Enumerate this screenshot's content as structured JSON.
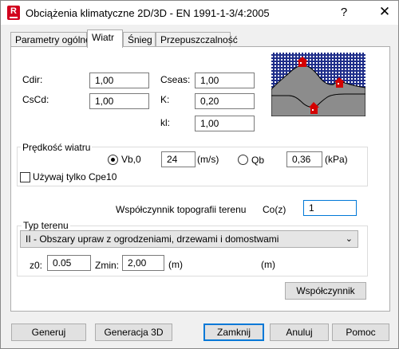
{
  "window": {
    "title": "Obciążenia klimatyczne 2D/3D - EN 1991-1-3/4:2005",
    "help_label": "?",
    "close_label": "✕",
    "app_icon_letter": "R"
  },
  "tabs": [
    {
      "label": "Parametry ogólne",
      "active": false
    },
    {
      "label": "Wiatr",
      "active": true
    },
    {
      "label": "Śnieg",
      "active": false
    },
    {
      "label": "Przepuszczalność",
      "active": false
    }
  ],
  "params": {
    "cdir_label": "Cdir:",
    "cdir_value": "1,00",
    "cscd_label": "CsCd:",
    "cscd_value": "1,00",
    "cseas_label": "Cseas:",
    "cseas_value": "1,00",
    "k_label": "K:",
    "k_value": "0,20",
    "kl_label": "kl:",
    "kl_value": "1,00"
  },
  "wind_speed": {
    "group_title": "Prędkość wiatru",
    "vb_label": "Vb,0",
    "vb_value": "24",
    "vb_unit": "(m/s)",
    "qb_label": "Qb",
    "qb_value": "0,36",
    "qb_unit": "(kPa)",
    "selected": "vb",
    "cpe10_label": "Używaj tylko Cpe10",
    "cpe10_checked": false
  },
  "topography": {
    "label": "Współczynnik topografii terenu",
    "coz_label": "Co(z)",
    "coz_value": "1"
  },
  "terrain": {
    "group_title": "Typ terenu",
    "selected_option": "II - Obszary upraw z ogrodzeniami, drzewami i domostwami",
    "z0_label": "z0:",
    "z0_value": "0.05",
    "zmin_label": "Zmin:",
    "zmin_value": "2,00",
    "unit_m_1": "(m)",
    "unit_m_2": "(m)"
  },
  "coefficient_button": "Współczynnik",
  "footer_buttons": {
    "generate": "Generuj",
    "generate_3d": "Generacja 3D",
    "close": "Zamknij",
    "cancel": "Anuluj",
    "help": "Pomoc"
  },
  "colors": {
    "sky": "#1f2e8a",
    "terrain": "#8c8c8c",
    "house": "#d40000"
  }
}
